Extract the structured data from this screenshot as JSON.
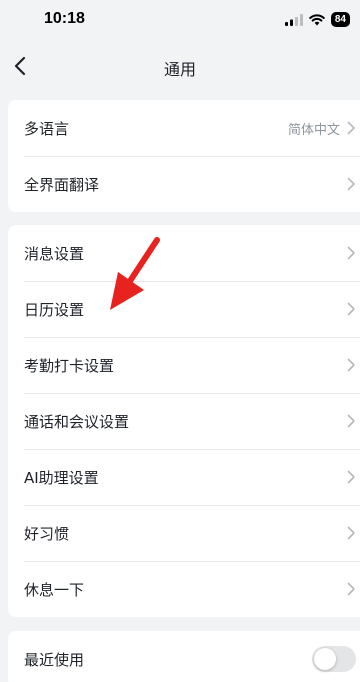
{
  "status_bar": {
    "time": "10:18",
    "battery": "84",
    "icons": [
      "signal-icon",
      "wifi-icon",
      "battery-icon"
    ]
  },
  "nav": {
    "title": "通用",
    "back_icon": "chevron-left-icon"
  },
  "groups": [
    {
      "items": [
        {
          "label": "多语言",
          "value": "简体中文"
        },
        {
          "label": "全界面翻译"
        }
      ]
    },
    {
      "items": [
        {
          "label": "消息设置"
        },
        {
          "label": "日历设置"
        },
        {
          "label": "考勤打卡设置"
        },
        {
          "label": "通话和会议设置"
        },
        {
          "label": "AI助理设置"
        },
        {
          "label": "好习惯"
        },
        {
          "label": "休息一下"
        }
      ]
    },
    {
      "items": [
        {
          "label": "最近使用",
          "toggle": false
        }
      ]
    }
  ],
  "colors": {
    "background": "#f2f3f5",
    "card": "#ffffff",
    "annotation_arrow": "#e8231f"
  }
}
